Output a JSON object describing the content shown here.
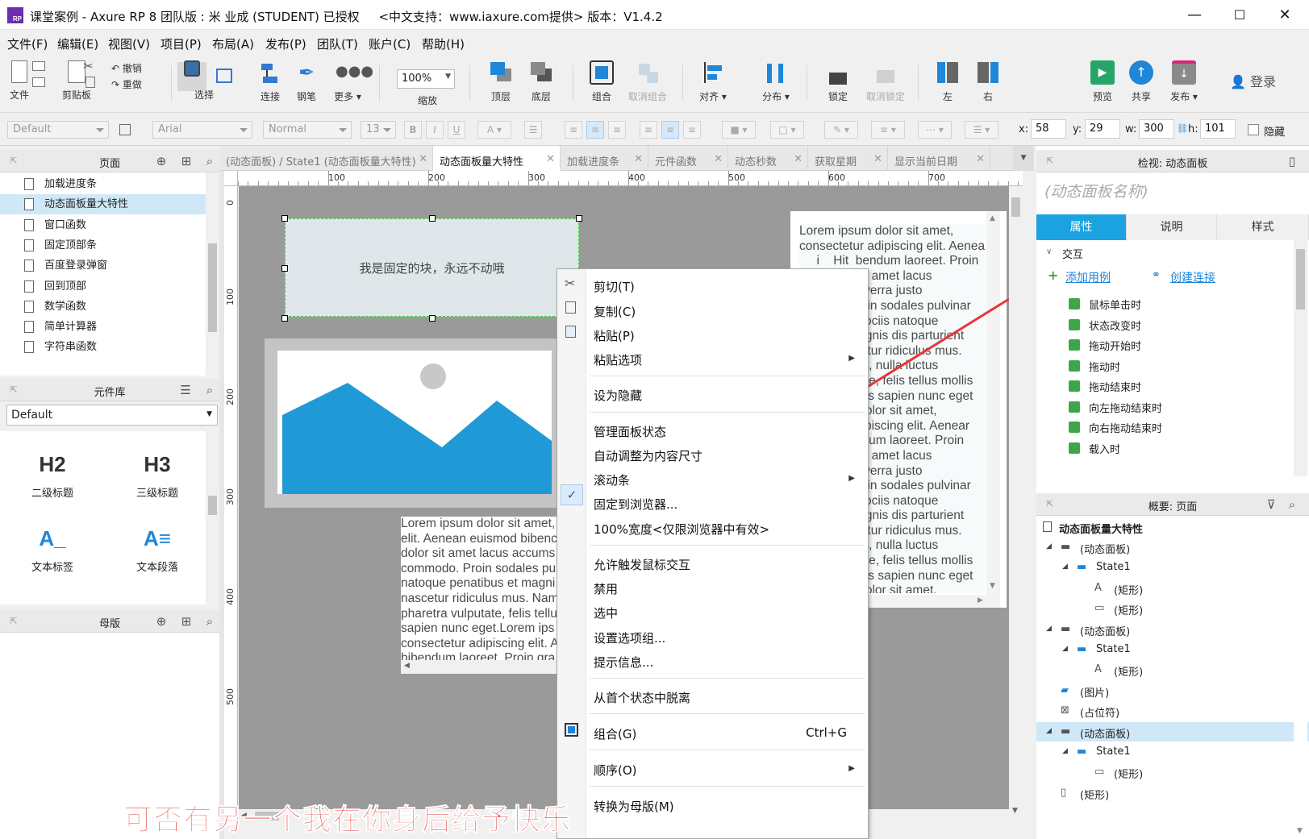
{
  "window": {
    "title": "课堂案例 - Axure RP 8 团队版 : 米 业成 (STUDENT) 已授权     <中文支持：www.iaxure.com提供> 版本：V1.4.2",
    "icon_text": "RP",
    "minimize": "—",
    "maximize": "☐",
    "close": "✕"
  },
  "menu": [
    "文件(F)",
    "编辑(E)",
    "视图(V)",
    "项目(P)",
    "布局(A)",
    "发布(P)",
    "团队(T)",
    "账户(C)",
    "帮助(H)"
  ],
  "toolbar": {
    "file": "文件",
    "clipboard": "剪贴板",
    "undo": "撤销",
    "redo": "重做",
    "select": "选择",
    "connect": "连接",
    "pen": "钢笔",
    "more": "更多 ▾",
    "zoom_value": "100%",
    "zoom": "缩放",
    "front": "顶层",
    "back": "底层",
    "group": "组合",
    "ungroup": "取消组合",
    "align": "对齐 ▾",
    "distribute": "分布 ▾",
    "lock": "锁定",
    "unlock": "取消锁定",
    "left": "左",
    "right": "右",
    "preview": "预览",
    "share": "共享",
    "publish": "发布 ▾",
    "login": "登录"
  },
  "format": {
    "style": "Default",
    "font": "Arial",
    "weight": "Normal",
    "size": "13",
    "x_label": "x:",
    "x": "58",
    "y_label": "y:",
    "y": "29",
    "w_label": "w:",
    "w": "300",
    "h_label": "h:",
    "h": "101",
    "hidden": "隐藏"
  },
  "pages_panel": {
    "title": "页面",
    "items": [
      "加载进度条",
      "动态面板量大特性",
      "窗口函数",
      "固定顶部条",
      "百度登录弹窗",
      "回到顶部",
      "数学函数",
      "简单计算器",
      "字符串函数"
    ],
    "selected_index": 1
  },
  "library_panel": {
    "title": "元件库",
    "library": "Default",
    "items": [
      {
        "glyph": "H2",
        "label": "二级标题"
      },
      {
        "glyph": "H3",
        "label": "三级标题"
      },
      {
        "glyph": "A_",
        "label": "文本标签"
      },
      {
        "glyph": "A≡",
        "label": "文本段落"
      }
    ]
  },
  "masters_panel": {
    "title": "母版"
  },
  "tabs": [
    {
      "label": "(动态面板) / State1 (动态面板量大特性)",
      "active": false
    },
    {
      "label": "动态面板量大特性",
      "active": true
    },
    {
      "label": "加载进度条",
      "active": false
    },
    {
      "label": "元件函数",
      "active": false
    },
    {
      "label": "动态秒数",
      "active": false
    },
    {
      "label": "获取星期",
      "active": false
    },
    {
      "label": "显示当前日期",
      "active": false
    }
  ],
  "ruler": {
    "h_labels": [
      "100",
      "200",
      "300",
      "400",
      "500",
      "600",
      "700"
    ],
    "v_labels": [
      "0",
      "100",
      "200",
      "300",
      "400",
      "500"
    ]
  },
  "canvas": {
    "fixed_block_text": "我是固定的块，永远不动哦",
    "lorem_right": "Lorem ipsum dolor sit amet,\nconsectetur adipiscing elit. Aenear\n     i    Hit  bendum laoreet. Proin\n              r sit amet lacus\n              t viverra justo\n              Proin sodales pulvinar\n              n sociis natoque\n              magnis dis parturient\n              scetur ridiculus mus.\n              tum, nulla luctus\n              utate, felis tellus mollis\n              ncus sapien nunc eget\n              n dolor sit amet,\n              adipiscing elit. Aenear\n              endum laoreet. Proin\n              r sit amet lacus\n              t viverra justo\n              Proin sodales pulvinar\n              n sociis natoque\n              magnis dis parturient\n              scetur ridiculus mus.\n              tum, nulla luctus\n              utate, felis tellus mollis\n              ncus sapien nunc eget\n              n dolor sit amet.",
    "lorem_bottom": "Lorem ipsum dolor sit amet,\nelit. Aenean euismod bibenc\ndolor sit amet lacus accums\ncommodo. Proin sodales pu\nnatoque penatibus et magni\nnascetur ridiculus mus. Nam\npharetra vulputate, felis tellus\nsapien nunc eget.Lorem ips\nconsectetur adipiscing elit. A\nbibendum laoreet. Proin gra"
  },
  "context_menu": {
    "cut": "剪切(T)",
    "copy": "复制(C)",
    "paste": "粘贴(P)",
    "paste_options": "粘贴选项",
    "set_hidden": "设为隐藏",
    "manage_states": "管理面板状态",
    "auto_fit": "自动调整为内容尺寸",
    "scrollbars": "滚动条",
    "pin_browser": "固定到浏览器...",
    "full_width": "100%宽度<仅限浏览器中有效>",
    "allow_mouse": "允许触发鼠标交互",
    "disable": "禁用",
    "selected": "选中",
    "option_group": "设置选项组...",
    "tooltip": "提示信息...",
    "detach": "从首个状态中脱离",
    "group": "组合(G)",
    "group_shortcut": "Ctrl+G",
    "order": "顺序(O)",
    "to_master": "转换为母版(M)",
    "check": "✓"
  },
  "inspector": {
    "title": "检视: 动态面板",
    "name_placeholder": "(动态面板名称)",
    "tabs": [
      "属性",
      "说明",
      "样式"
    ],
    "interaction": "交互",
    "add_case": "添加用例",
    "create_link": "创建连接",
    "events": [
      "鼠标单击时",
      "状态改变时",
      "拖动开始时",
      "拖动时",
      "拖动结束时",
      "向左拖动结束时",
      "向右拖动结束时",
      "载入时"
    ]
  },
  "outline": {
    "title": "概要: 页面",
    "page": "动态面板量大特性",
    "items": [
      {
        "label": "(动态面板)",
        "depth": 0,
        "kind": "panel"
      },
      {
        "label": "State1",
        "depth": 1,
        "kind": "state"
      },
      {
        "label": "(矩形)",
        "depth": 2,
        "kind": "text"
      },
      {
        "label": "(矩形)",
        "depth": 2,
        "kind": "rect"
      },
      {
        "label": "(动态面板)",
        "depth": 0,
        "kind": "panel"
      },
      {
        "label": "State1",
        "depth": 1,
        "kind": "state"
      },
      {
        "label": "(矩形)",
        "depth": 2,
        "kind": "text"
      },
      {
        "label": "(图片)",
        "depth": 0,
        "kind": "image"
      },
      {
        "label": "(占位符)",
        "depth": 0,
        "kind": "placeholder"
      },
      {
        "label": "(动态面板)",
        "depth": 0,
        "kind": "panel"
      },
      {
        "label": "State1",
        "depth": 1,
        "kind": "state"
      },
      {
        "label": "(矩形)",
        "depth": 2,
        "kind": "line"
      },
      {
        "label": "(矩形)",
        "depth": 0,
        "kind": "vrect"
      }
    ]
  },
  "subtitle": "可否有另一个我在你身后给予快乐",
  "colors": {
    "accent": "#1aa3e0",
    "arrow": "#e8373a",
    "subtitle": "#e63b3b",
    "selection": "#cfe8f8",
    "canvas_bg": "#9a9a9a"
  }
}
